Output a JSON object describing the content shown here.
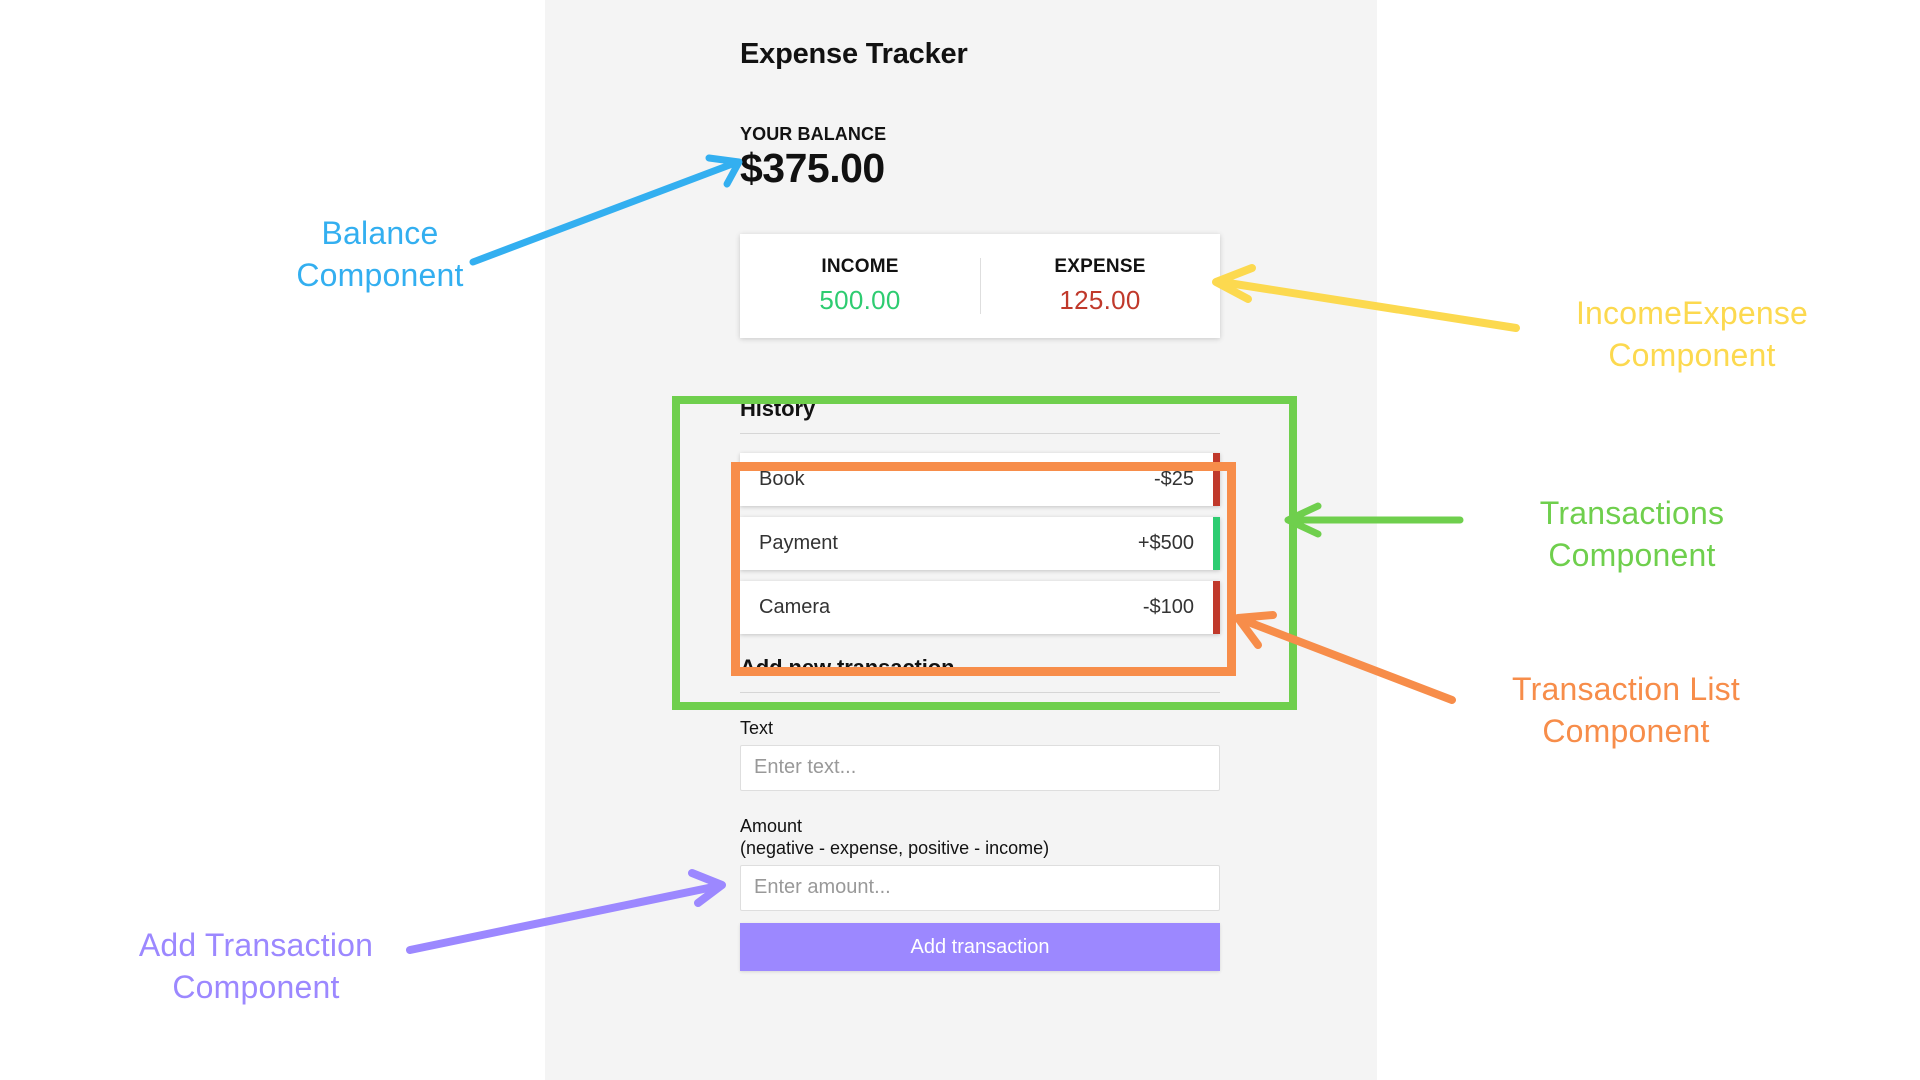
{
  "app": {
    "title": "Expense Tracker",
    "balance_label": "YOUR BALANCE",
    "balance_amount": "$375.00"
  },
  "income_expense": {
    "income_label": "INCOME",
    "income_value": "500.00",
    "expense_label": "EXPENSE",
    "expense_value": "125.00",
    "income_color": "#2ecc71",
    "expense_color": "#c0392b"
  },
  "history": {
    "heading": "History",
    "transactions": [
      {
        "name": "Book",
        "amount": "-$25",
        "sign": "minus",
        "bar_color": "#c0392b"
      },
      {
        "name": "Payment",
        "amount": "+$500",
        "sign": "plus",
        "bar_color": "#2ecc71"
      },
      {
        "name": "Camera",
        "amount": "-$100",
        "sign": "minus",
        "bar_color": "#c0392b"
      }
    ]
  },
  "add_form": {
    "heading": "Add new transaction",
    "text_label": "Text",
    "text_placeholder": "Enter text...",
    "amount_label": "Amount",
    "amount_hint": "(negative - expense, positive - income)",
    "amount_placeholder": "Enter amount...",
    "submit_label": "Add transaction",
    "submit_color": "#9c88ff"
  },
  "annotations": [
    {
      "id": "balance",
      "text": "Balance\nComponent",
      "color": "#33aff0"
    },
    {
      "id": "income_expense",
      "text": "IncomeExpense\nComponent",
      "color": "#fcd94f"
    },
    {
      "id": "transactions",
      "text": "Transactions\nComponent",
      "color": "#6fcf4d"
    },
    {
      "id": "transaction_list",
      "text": "Transaction List\nComponent",
      "color": "#f78d4a"
    },
    {
      "id": "add_transaction",
      "text": "Add Transaction\nComponent",
      "color": "#9c88ff"
    }
  ]
}
